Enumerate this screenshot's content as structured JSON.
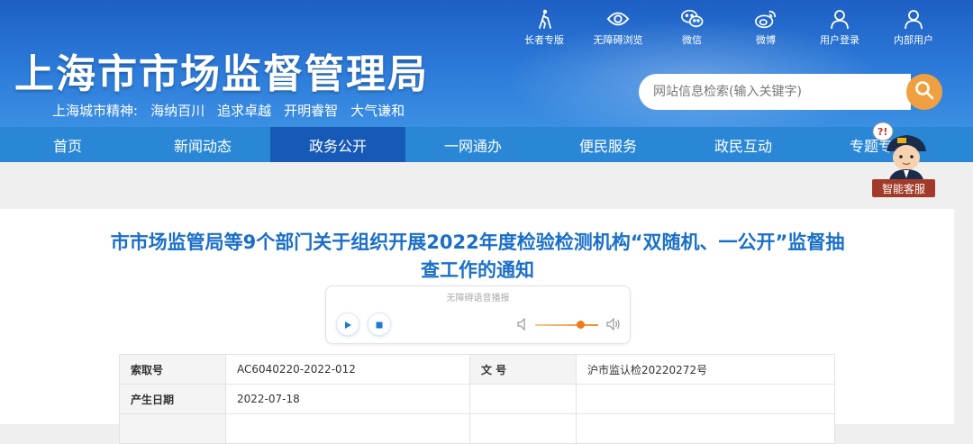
{
  "header": {
    "site_title": "上海市市场监督管理局",
    "slogan": [
      "上海城市精神:",
      "海纳百川",
      "追求卓越",
      "开明睿智",
      "大气谦和"
    ],
    "top_links": [
      {
        "label": "长者专版",
        "icon": "elder-icon"
      },
      {
        "label": "无障碍浏览",
        "icon": "eye-icon"
      },
      {
        "label": "微信",
        "icon": "wechat-icon"
      },
      {
        "label": "微博",
        "icon": "weibo-icon"
      },
      {
        "label": "用户登录",
        "icon": "user-icon"
      },
      {
        "label": "内部用户",
        "icon": "user-icon"
      }
    ],
    "search_placeholder": "网站信息检索(输入关键字)"
  },
  "nav": {
    "items": [
      "首页",
      "新闻动态",
      "政务公开",
      "一网通办",
      "便民服务",
      "政民互动",
      "专题专栏"
    ],
    "active_index": 2
  },
  "agent": {
    "label": "智能客服"
  },
  "article": {
    "title": "市市场监管局等9个部门关于组织开展2022年度检验检测机构“双随机、一公开”监督抽查工作的通知",
    "player_label": "无障碍语音播报",
    "volume_level": 0.72
  },
  "meta": {
    "index_key": "索取号",
    "index_value": "AC6040220-2022-012",
    "doc_key": "文    号",
    "doc_value": "沪市监认检20220272号",
    "date_key": "产生日期",
    "date_value": "2022-07-18"
  },
  "colors": {
    "header_blue": "#1e5fc4",
    "nav_blue": "#2a87d6",
    "nav_active": "#1659b7",
    "title_blue": "#1a6fc9",
    "search_orange": "#f0a040"
  }
}
